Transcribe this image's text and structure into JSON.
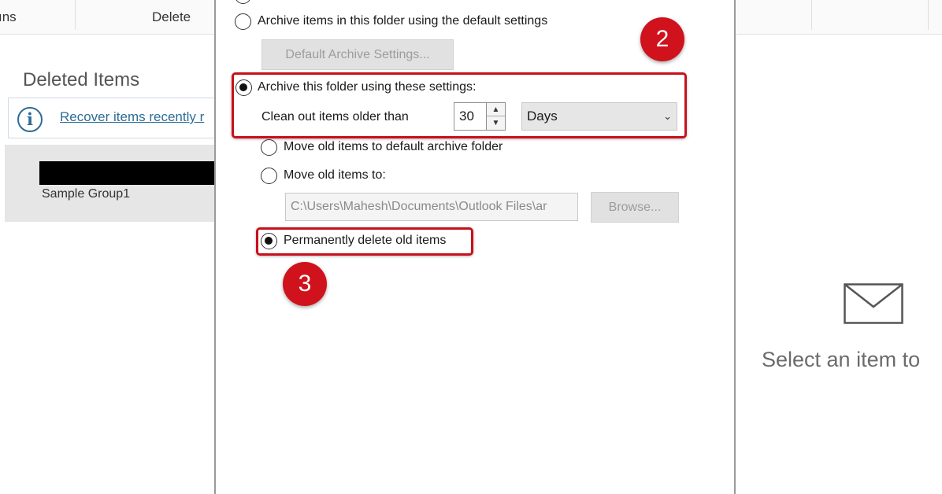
{
  "ribbon": {
    "partial_label": "ıns",
    "delete_label": "Delete"
  },
  "folder_list": {
    "title": "Deleted Items",
    "info_link": "Recover items recently r",
    "item_sender": "Sample Group1"
  },
  "reading_pane": {
    "empty_text": "Select an item to"
  },
  "dialog": {
    "default_radio_label": "Archive items in this folder using the default settings",
    "default_settings_button": "Default Archive Settings...",
    "custom_radio_label": "Archive this folder using these settings:",
    "clean_out_label": "Clean out items older than",
    "age_value": "30",
    "age_unit": "Days",
    "move_default_label": "Move old items to default archive folder",
    "move_to_label": "Move old items to:",
    "archive_path": "C:\\Users\\Mahesh\\Documents\\Outlook Files\\ar",
    "browse_button": "Browse...",
    "delete_radio_label": "Permanently delete old items"
  },
  "annotations": {
    "marker_2": "2",
    "marker_3": "3",
    "highlight_color": "#c8101c"
  }
}
